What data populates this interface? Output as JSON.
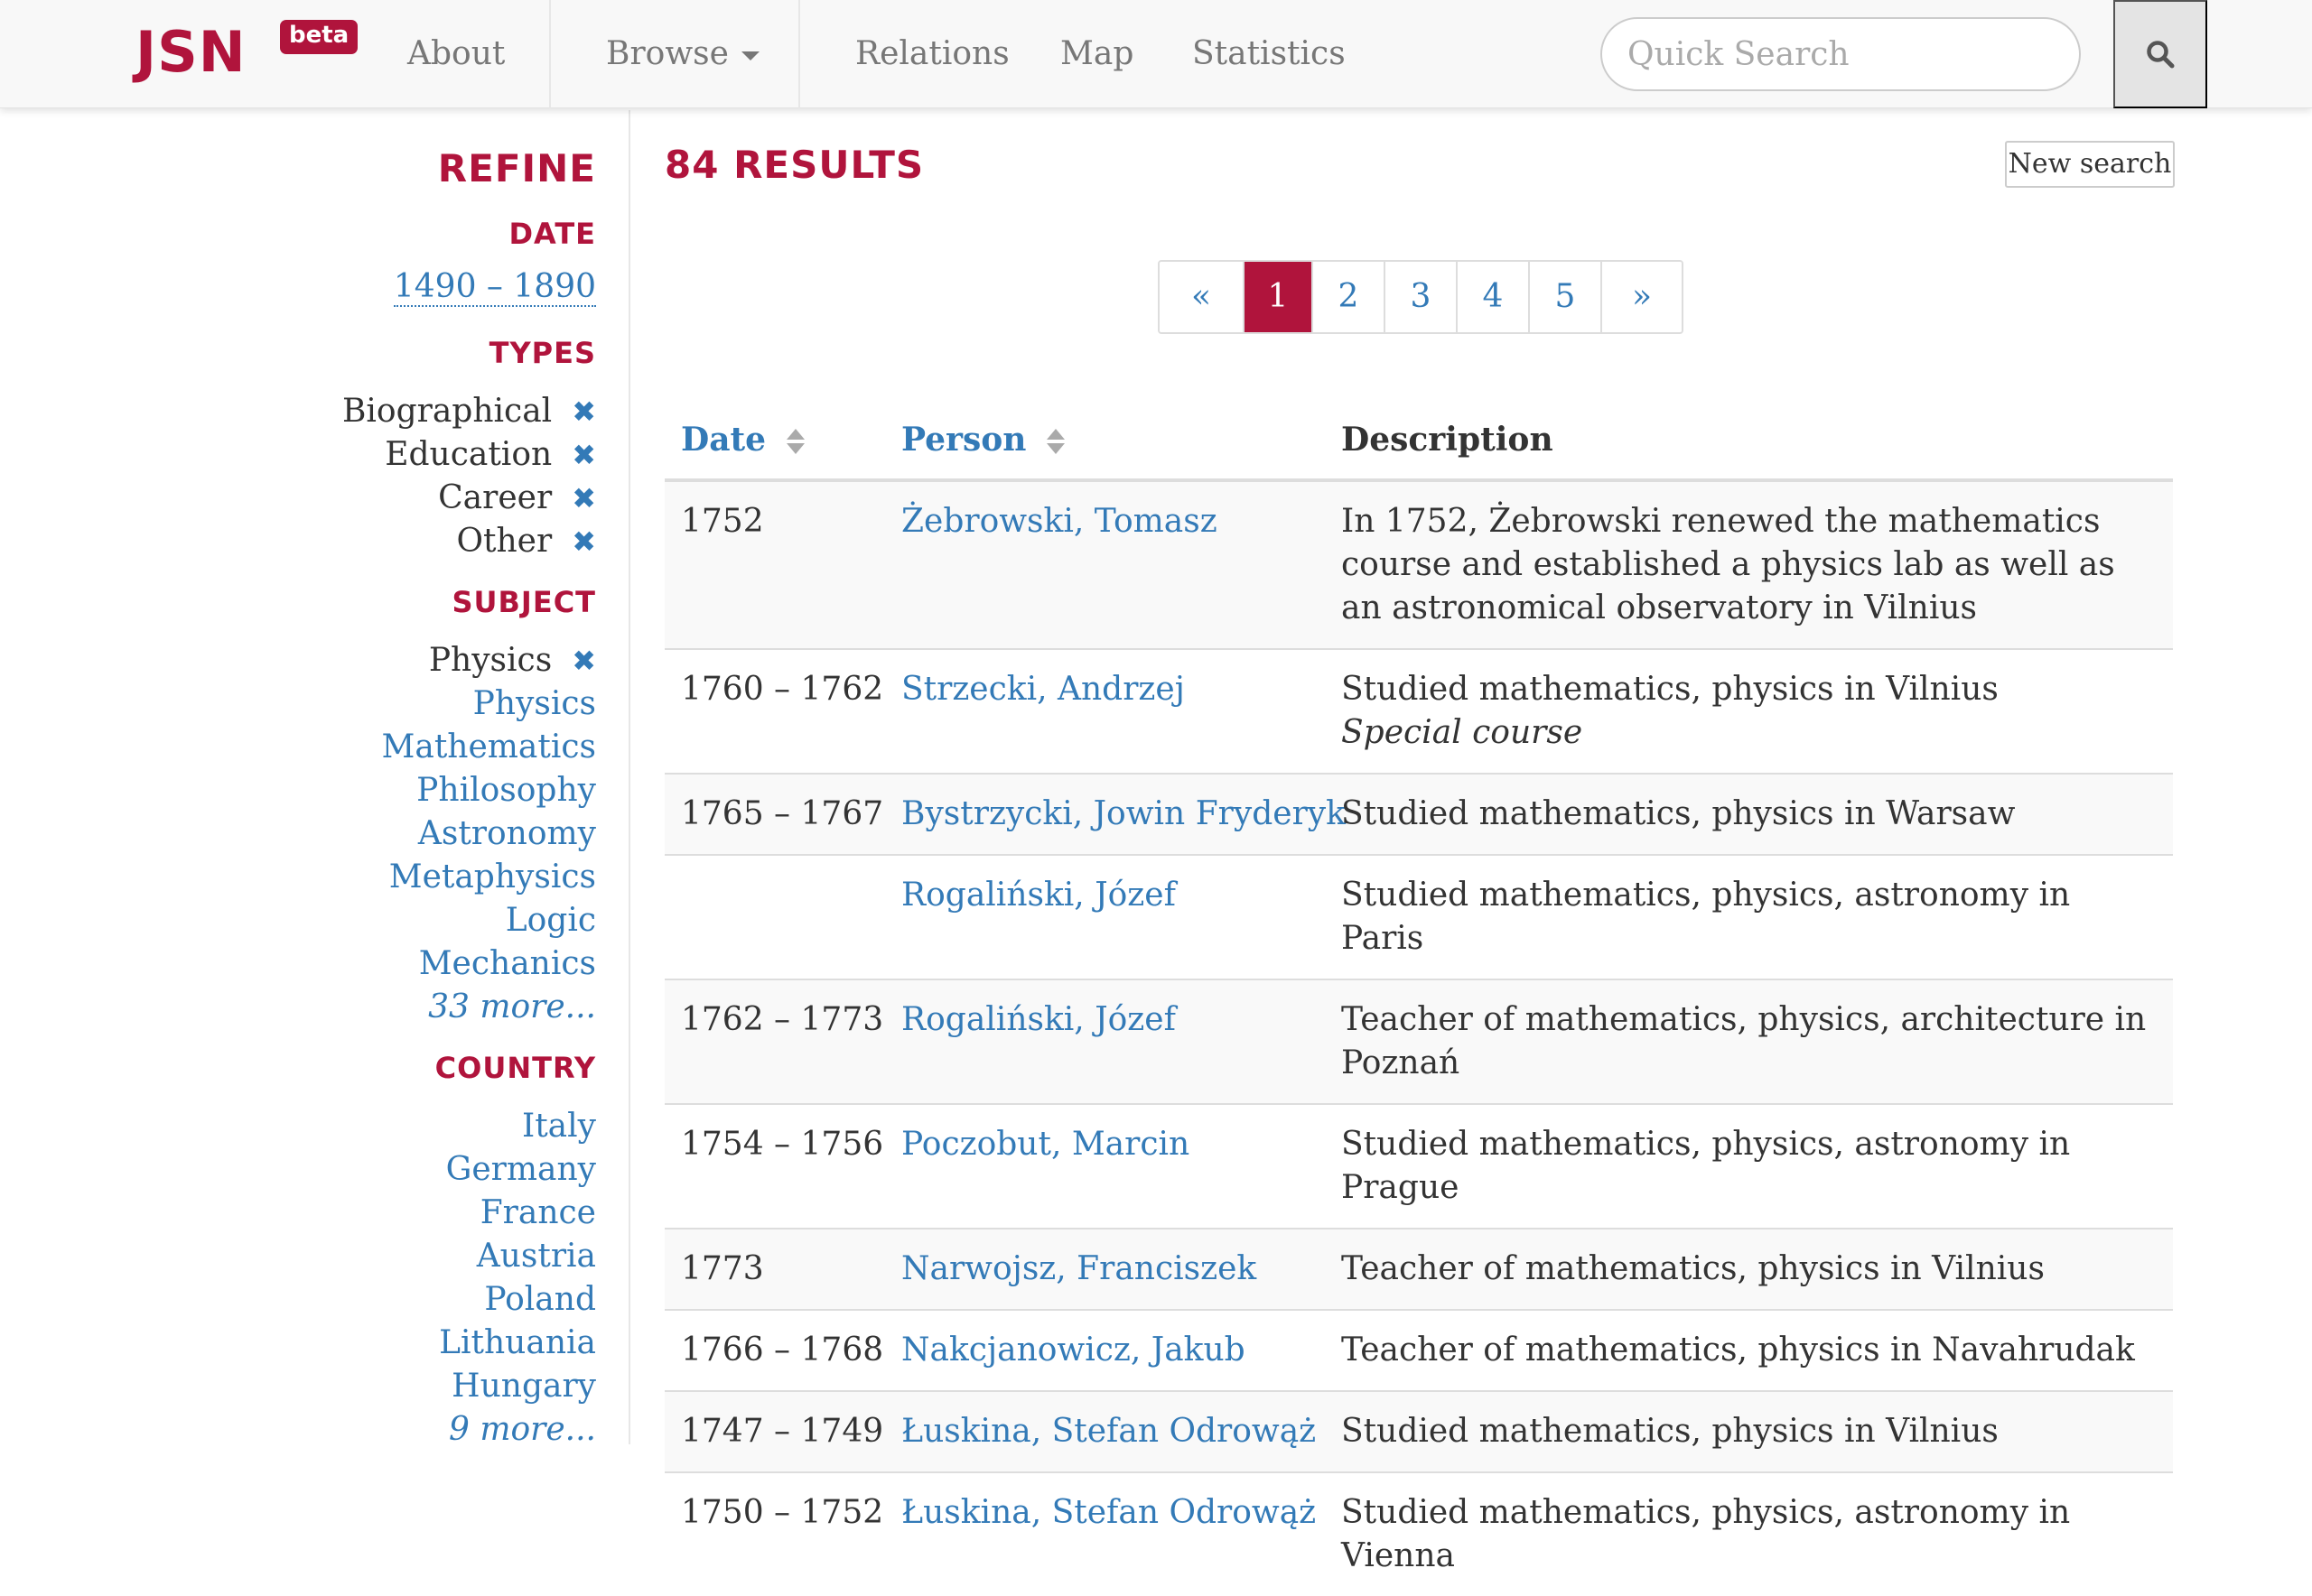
{
  "brand": {
    "name": "JSN",
    "badge": "beta"
  },
  "nav": {
    "about": "About",
    "browse": "Browse",
    "relations": "Relations",
    "map": "Map",
    "statistics": "Statistics",
    "search_placeholder": "Quick Search",
    "search_icon": "search-icon"
  },
  "sidebar": {
    "title": "REFINE",
    "date": {
      "heading": "DATE",
      "range": "1490 – 1890"
    },
    "types": {
      "heading": "TYPES",
      "selected": [
        "Biographical",
        "Education",
        "Career",
        "Other"
      ]
    },
    "subject": {
      "heading": "SUBJECT",
      "selected": [
        "Physics"
      ],
      "options": [
        "Physics",
        "Mathematics",
        "Philosophy",
        "Astronomy",
        "Metaphysics",
        "Logic",
        "Mechanics"
      ],
      "more": "33 more..."
    },
    "country": {
      "heading": "COUNTRY",
      "options": [
        "Italy",
        "Germany",
        "France",
        "Austria",
        "Poland",
        "Lithuania",
        "Hungary"
      ],
      "more": "9 more..."
    },
    "remove_icon": "close-icon",
    "remove_glyph": "✖"
  },
  "results": {
    "title": "84 RESULTS",
    "new_search": "New search",
    "pagination": {
      "prev": "«",
      "pages": [
        "1",
        "2",
        "3",
        "4",
        "5"
      ],
      "active": "1",
      "next": "»"
    },
    "columns": {
      "date": "Date",
      "person": "Person",
      "description": "Description"
    },
    "rows": [
      {
        "date": "1752",
        "person": "Żebrowski, Tomasz",
        "description": "In 1752, Żebrowski renewed the mathematics course and established a physics lab as well as an astronomical observatory in Vilnius",
        "note": ""
      },
      {
        "date": "1760 – 1762",
        "person": "Strzecki, Andrzej",
        "description": "Studied mathematics, physics in Vilnius",
        "note": "Special course"
      },
      {
        "date": "1765 – 1767",
        "person": "Bystrzycki, Jowin Fryderyk",
        "description": "Studied mathematics, physics in Warsaw",
        "note": ""
      },
      {
        "date": "",
        "person": "Rogaliński, Józef",
        "description": "Studied mathematics, physics, astronomy in Paris",
        "note": ""
      },
      {
        "date": "1762 – 1773",
        "person": "Rogaliński, Józef",
        "description": "Teacher of mathematics, physics, architecture in Poznań",
        "note": ""
      },
      {
        "date": "1754 – 1756",
        "person": "Poczobut, Marcin",
        "description": "Studied mathematics, physics, astronomy in Prague",
        "note": ""
      },
      {
        "date": "1773",
        "person": "Narwojsz, Franciszek",
        "description": "Teacher of mathematics, physics in Vilnius",
        "note": ""
      },
      {
        "date": "1766 – 1768",
        "person": "Nakcjanowicz, Jakub",
        "description": "Teacher of mathematics, physics in Navahrudak",
        "note": ""
      },
      {
        "date": "1747 – 1749",
        "person": "Łuskina, Stefan Odrowąż",
        "description": "Studied mathematics, physics in Vilnius",
        "note": ""
      },
      {
        "date": "1750 – 1752",
        "person": "Łuskina, Stefan Odrowąż",
        "description": "Studied mathematics, physics, astronomy in Vienna",
        "note": ""
      }
    ]
  },
  "colors": {
    "brand": "#b0143c",
    "link": "#337ab7",
    "text": "#333333"
  }
}
